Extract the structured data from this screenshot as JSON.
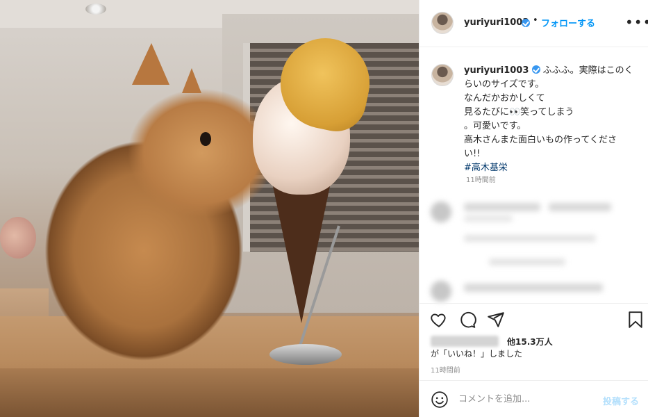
{
  "post": {
    "username": "yuriyuri1003",
    "follow_label": "フォローする",
    "more_label": "•••",
    "separator": "•"
  },
  "caption": {
    "username": "yuriyuri1003",
    "lines": [
      "ふふふ。実際はこのく",
      "らいのサイズです。",
      "なんだかおかしくて",
      "見るたびに👀笑ってしまう",
      "。可愛いです。",
      "高木さんまた面白いもの作ってくださ",
      "い!!"
    ],
    "hashtag": "#高木基栄",
    "time": "11時間前"
  },
  "likes": {
    "count_text": "他15.3万人",
    "suffix_text": "が「いいね！」しました"
  },
  "post_time": "11時間前",
  "comment_box": {
    "placeholder": "コメントを追加...",
    "post_label": "投稿する"
  },
  "icons": {
    "like": "heart-icon",
    "comment": "comment-icon",
    "share": "share-icon",
    "save": "bookmark-icon",
    "emoji": "emoji-icon"
  },
  "colors": {
    "accent": "#0095f6",
    "verified": "#3897f0",
    "hashtag": "#00376b",
    "post_disabled": "#b2dffc"
  }
}
